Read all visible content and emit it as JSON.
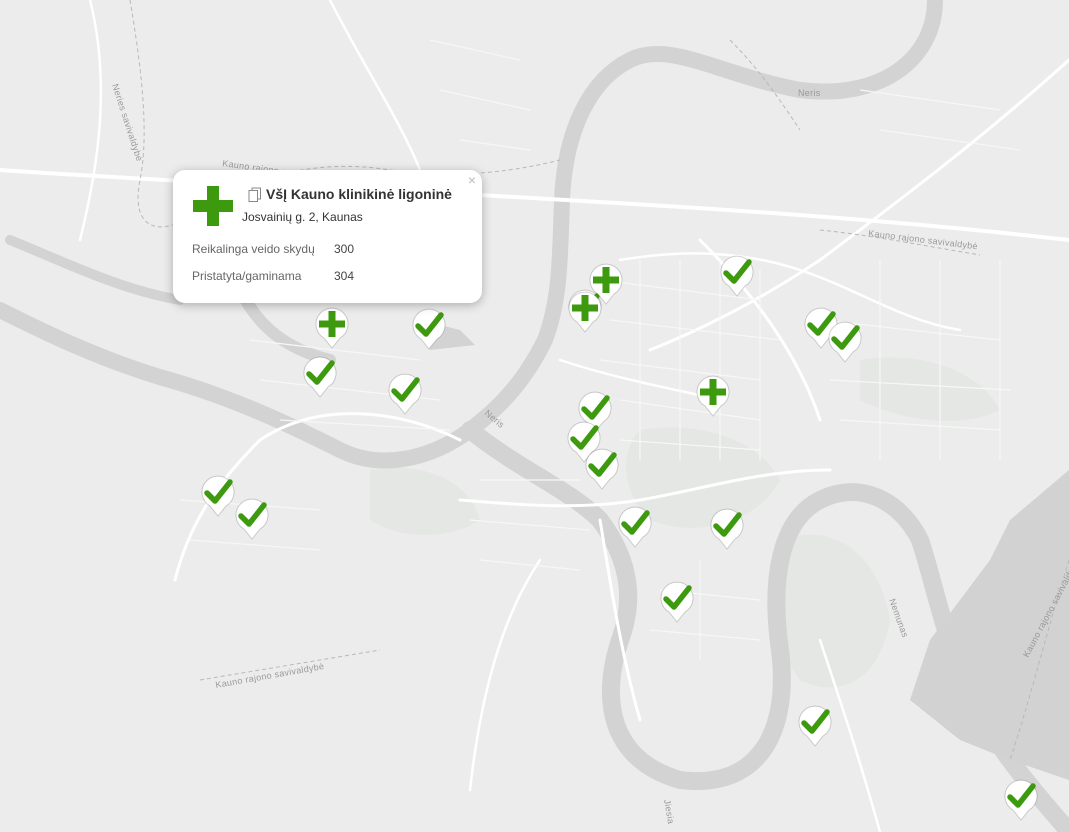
{
  "map": {
    "labels": {
      "neris_north": "Neris",
      "neris_mid": "Neris",
      "nemunas": "Nemunas",
      "kauno_rajono_1": "Kauno rajono savivaldybė",
      "kauno_rajono_2": "Kauno rajono savivaldybė",
      "kauno_rajono_3": "Kauno rajono savivaldybė",
      "kauno_rajono_4": "Kauno rajono savivaldybė",
      "neries_savivaldybe": "Neries savivaldybė",
      "jesia": "Jiesia"
    },
    "colors": {
      "background": "#ececec",
      "water": "#d2d2d2",
      "road": "#ffffff",
      "park": "#e3e6e3",
      "marker_green": "#3d9a0e"
    }
  },
  "markers": [
    {
      "id": "check-1",
      "icon": "checkmark-icon"
    },
    {
      "id": "check-2",
      "icon": "checkmark-icon"
    },
    {
      "id": "check-3",
      "icon": "checkmark-icon"
    },
    {
      "id": "check-4",
      "icon": "checkmark-icon"
    },
    {
      "id": "check-5",
      "icon": "checkmark-icon"
    },
    {
      "id": "check-6",
      "icon": "checkmark-icon"
    },
    {
      "id": "check-7",
      "icon": "checkmark-icon"
    },
    {
      "id": "check-8",
      "icon": "checkmark-icon"
    },
    {
      "id": "check-9",
      "icon": "checkmark-icon"
    },
    {
      "id": "check-10",
      "icon": "checkmark-icon"
    },
    {
      "id": "check-11",
      "icon": "checkmark-icon"
    },
    {
      "id": "check-12",
      "icon": "checkmark-icon"
    },
    {
      "id": "check-13",
      "icon": "checkmark-icon"
    },
    {
      "id": "check-14",
      "icon": "checkmark-icon"
    },
    {
      "id": "check-15",
      "icon": "checkmark-icon"
    },
    {
      "id": "check-16",
      "icon": "checkmark-icon"
    },
    {
      "id": "check-17",
      "icon": "checkmark-icon"
    },
    {
      "id": "plus-1",
      "icon": "plus-icon"
    },
    {
      "id": "plus-2",
      "icon": "plus-icon"
    },
    {
      "id": "plus-3",
      "icon": "plus-icon"
    },
    {
      "id": "plus-4",
      "icon": "plus-icon"
    }
  ],
  "popup": {
    "title": "VšĮ Kauno klinikinė ligoninė",
    "address": "Josvainių g. 2, Kaunas",
    "close_label": "×",
    "rows": [
      {
        "label": "Reikalinga veido skydų",
        "value": "300"
      },
      {
        "label": "Pristatyta/gaminama",
        "value": "304"
      }
    ]
  }
}
